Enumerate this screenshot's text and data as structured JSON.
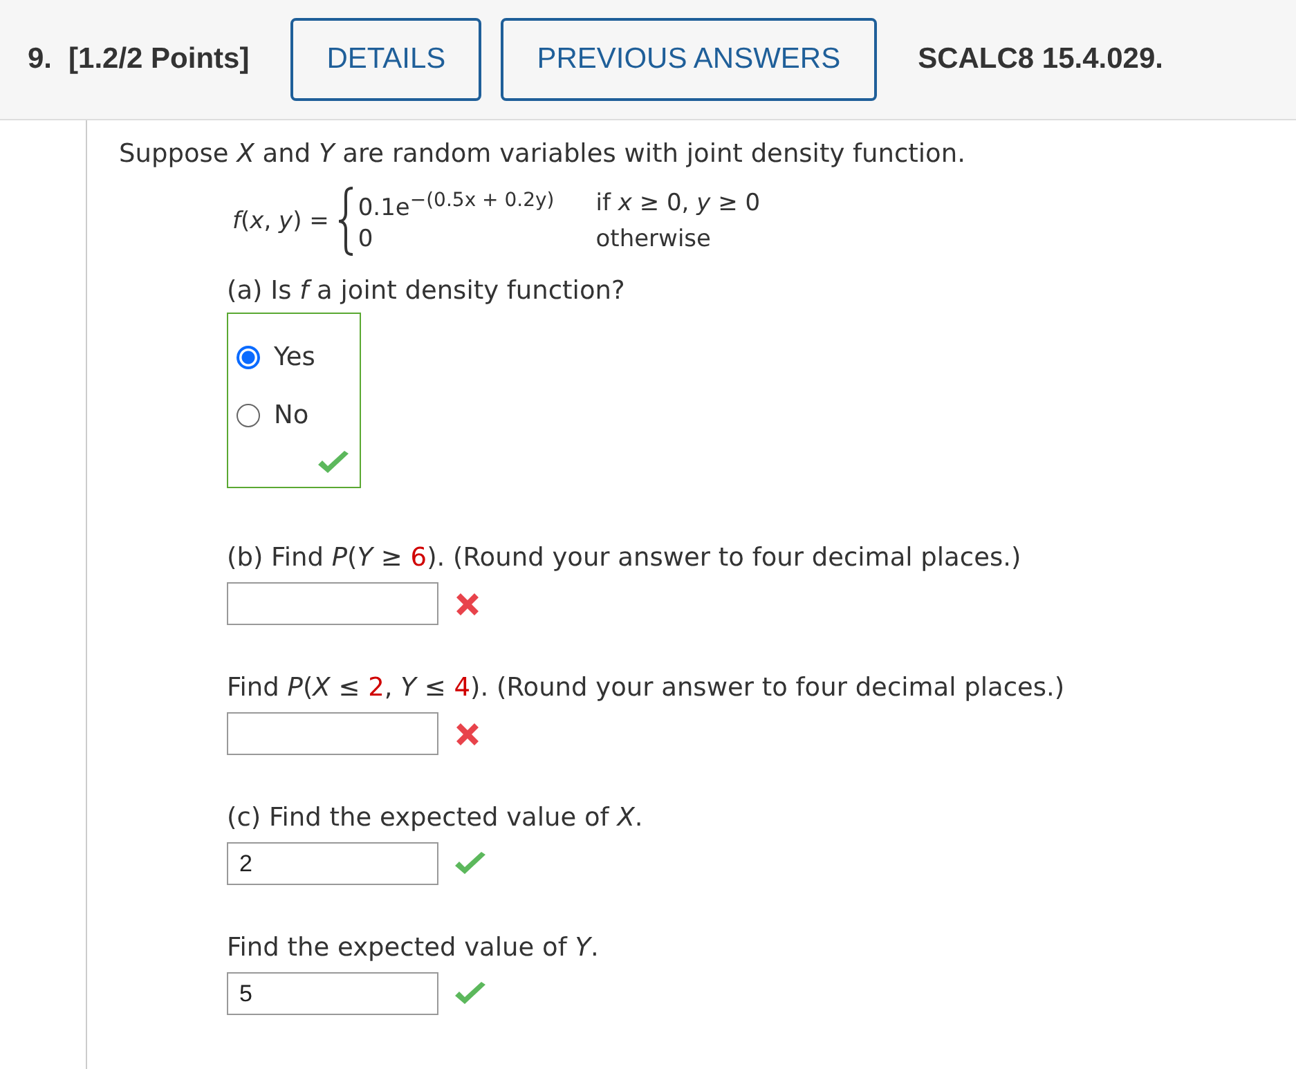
{
  "header": {
    "number": "9.",
    "points": "[1.2/2 Points]",
    "buttons": [
      "DETAILS",
      "PREVIOUS ANSWERS"
    ],
    "code": "SCALC8 15.4.029."
  },
  "intro": "Suppose *X* and *Y* are random variables with joint density function.",
  "formula": {
    "lhs": "*f*(*x*, *y*) =",
    "cases": [
      {
        "base": "0.1e",
        "exponent": "−(0.5x + 0.2y)",
        "condition": "if *x* ≥ 0, *y* ≥ 0"
      },
      {
        "base": "0",
        "condition": "otherwise"
      }
    ]
  },
  "parts": [
    {
      "kind": "radio",
      "prompt": [
        {
          "kind": "text",
          "text": "(a) Is *f* a joint density function?"
        }
      ],
      "options": [
        {
          "label": "Yes",
          "selected": true
        },
        {
          "label": "No",
          "selected": false
        }
      ],
      "correct": true
    },
    {
      "kind": "input",
      "prompt": [
        {
          "kind": "text",
          "text": "(b) Find *P*(*Y* ≥ "
        },
        {
          "kind": "given",
          "text": "6"
        },
        {
          "kind": "text",
          "text": "). (Round your answer to four decimal places.)"
        }
      ],
      "correct": false
    },
    {
      "kind": "input",
      "prompt": [
        {
          "kind": "text",
          "text": "Find *P*(*X* ≤ "
        },
        {
          "kind": "given",
          "text": "2"
        },
        {
          "kind": "text",
          "text": ", *Y* ≤ "
        },
        {
          "kind": "given",
          "text": "4"
        },
        {
          "kind": "text",
          "text": "). (Round your answer to four decimal places.)"
        }
      ],
      "correct": false
    },
    {
      "kind": "input",
      "prompt": [
        {
          "kind": "text",
          "text": "(c) Find the expected value of *X*."
        }
      ],
      "value": "2",
      "correct": true
    },
    {
      "kind": "input",
      "prompt": [
        {
          "kind": "text",
          "text": "Find the expected value of *Y*."
        }
      ],
      "value": "5",
      "correct": true
    }
  ]
}
